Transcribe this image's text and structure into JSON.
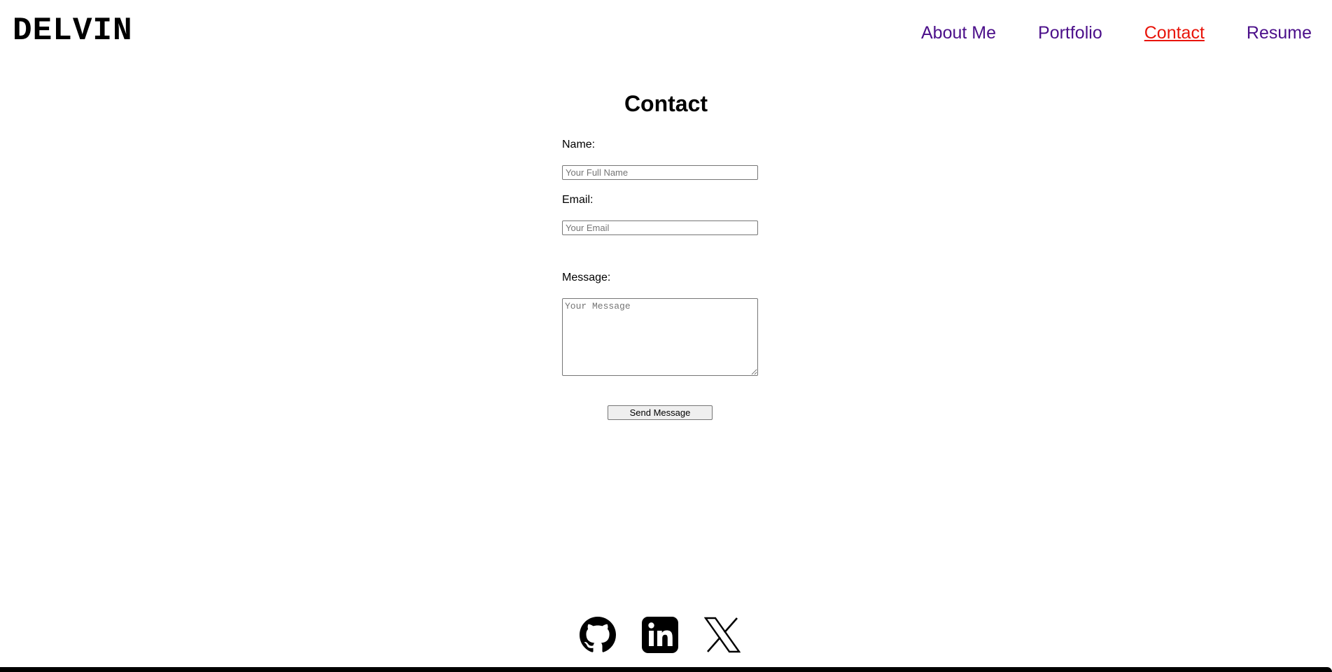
{
  "brand": {
    "logo": "DELVIN"
  },
  "nav": {
    "items": [
      {
        "label": "About Me",
        "active": false
      },
      {
        "label": "Portfolio",
        "active": false
      },
      {
        "label": "Contact",
        "active": true
      },
      {
        "label": "Resume",
        "active": false
      }
    ]
  },
  "contact": {
    "title": "Contact",
    "name_label": "Name:",
    "name_placeholder": "Your Full Name",
    "email_label": "Email:",
    "email_placeholder": "Your Email",
    "message_label": "Message:",
    "message_placeholder": "Your Message",
    "send_label": "Send Message"
  },
  "footer": {
    "socials": [
      {
        "icon": "github-icon"
      },
      {
        "icon": "linkedin-icon"
      },
      {
        "icon": "x-icon"
      }
    ]
  },
  "colors": {
    "nav_link": "#4b0f8a",
    "nav_active": "#e8140a"
  }
}
